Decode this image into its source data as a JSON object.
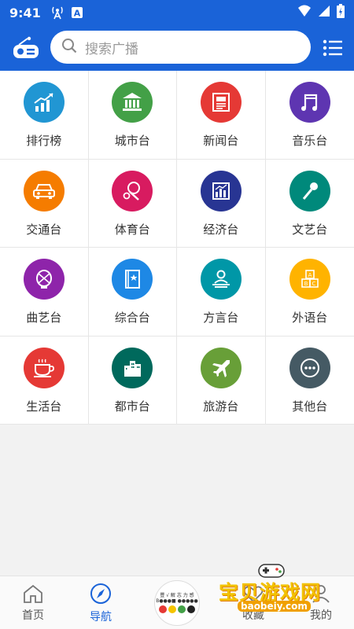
{
  "status_bar": {
    "time": "9:41",
    "notif_letter": "A"
  },
  "header": {
    "search_placeholder": "搜索广播"
  },
  "categories": [
    {
      "label": "排行榜",
      "icon": "trending-chart-icon",
      "color": "#2196d3"
    },
    {
      "label": "城市台",
      "icon": "bank-building-icon",
      "color": "#43a047"
    },
    {
      "label": "新闻台",
      "icon": "newspaper-icon",
      "color": "#e53935"
    },
    {
      "label": "音乐台",
      "icon": "music-note-icon",
      "color": "#5e35b1"
    },
    {
      "label": "交通台",
      "icon": "car-icon",
      "color": "#f57c00"
    },
    {
      "label": "体育台",
      "icon": "racket-ball-icon",
      "color": "#d81b60"
    },
    {
      "label": "经济台",
      "icon": "bar-chart-icon",
      "color": "#283593"
    },
    {
      "label": "文艺台",
      "icon": "microphone-icon",
      "color": "#00897b"
    },
    {
      "label": "曲艺台",
      "icon": "opera-mask-icon",
      "color": "#8e24aa"
    },
    {
      "label": "综合台",
      "icon": "book-star-icon",
      "color": "#1e88e5"
    },
    {
      "label": "方言台",
      "icon": "speaker-person-icon",
      "color": "#0097a7"
    },
    {
      "label": "外语台",
      "icon": "abc-blocks-icon",
      "color": "#ffb300"
    },
    {
      "label": "生活台",
      "icon": "coffee-cup-icon",
      "color": "#e53935"
    },
    {
      "label": "都市台",
      "icon": "city-buildings-icon",
      "color": "#00695c"
    },
    {
      "label": "旅游台",
      "icon": "airplane-icon",
      "color": "#689f38"
    },
    {
      "label": "其他台",
      "icon": "more-dots-icon",
      "color": "#455a64"
    }
  ],
  "tabs": [
    {
      "label": "首页",
      "icon": "home-icon"
    },
    {
      "label": "导航",
      "icon": "compass-icon"
    },
    {
      "label": "收藏",
      "icon": "heart-icon"
    },
    {
      "label": "我的",
      "icon": "person-icon"
    }
  ],
  "center_logo_text": [
    "豐 √ 解 志 力 感",
    "B●●●■ ●●●●●"
  ],
  "watermark": {
    "brand": "宝贝游戏网",
    "url": "baobeiy.com"
  },
  "colors": {
    "primary": "#1a63d8",
    "watermark": "#f2c200"
  }
}
